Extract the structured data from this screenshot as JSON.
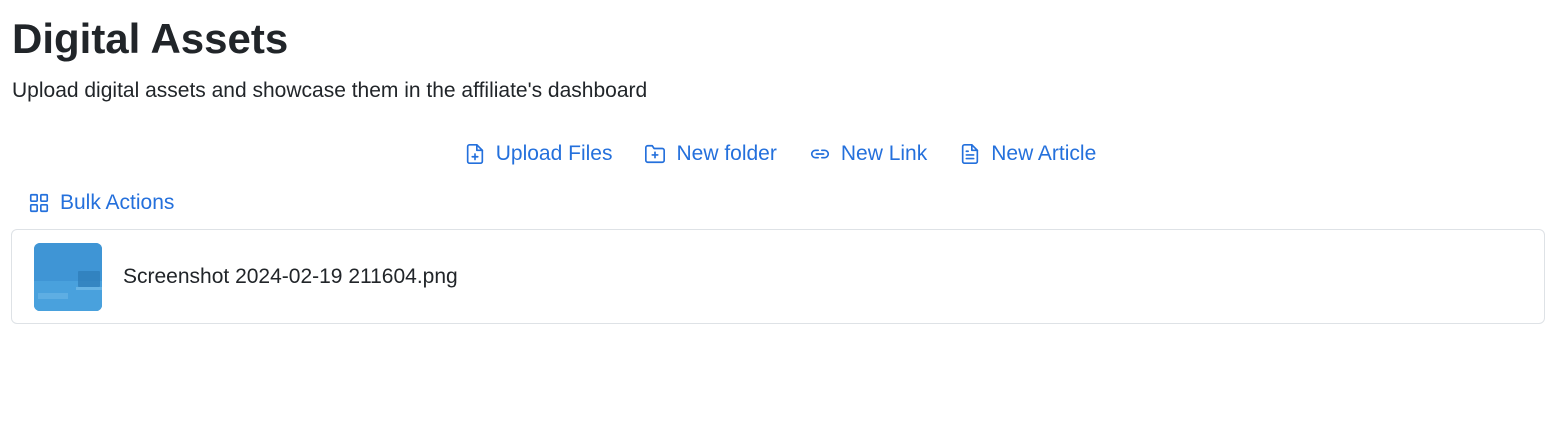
{
  "header": {
    "title": "Digital Assets",
    "subtitle": "Upload digital assets and showcase them in the affiliate's dashboard"
  },
  "toolbar": {
    "upload_files": "Upload Files",
    "new_folder": "New folder",
    "new_link": "New Link",
    "new_article": "New Article"
  },
  "bulk_actions": {
    "label": "Bulk Actions"
  },
  "assets": [
    {
      "name": "Screenshot 2024-02-19 211604.png",
      "thumbnail": "image-thumbnail"
    }
  ],
  "icons": {
    "upload": "file-plus-icon",
    "folder": "folder-plus-icon",
    "link": "link-icon",
    "article": "file-text-icon",
    "bulk": "grid-icon"
  },
  "colors": {
    "accent": "#2470dc",
    "text": "#212529",
    "border": "#dee2e6"
  }
}
